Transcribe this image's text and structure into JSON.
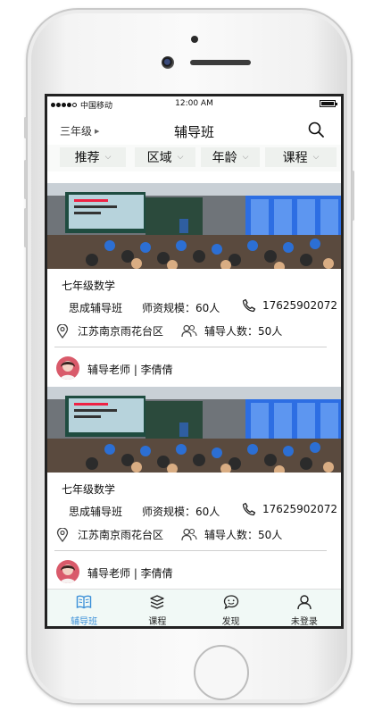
{
  "status_bar": {
    "carrier": "中国移动",
    "time": "12:00 AM"
  },
  "nav": {
    "grade": "三年级",
    "title": "辅导班",
    "search_icon": "search-icon"
  },
  "filters": [
    {
      "label": "推荐"
    },
    {
      "label": "区域"
    },
    {
      "label": "年龄"
    },
    {
      "label": "课程"
    }
  ],
  "listings": [
    {
      "course": "七年级数学",
      "org": "思成辅导班",
      "faculty": "师资规模：60人",
      "phone": "17625902072",
      "address": "江苏南京雨花台区",
      "students": "辅导人数：50人",
      "teacher": "辅导老师 | 李倩倩"
    },
    {
      "course": "七年级数学",
      "org": "思成辅导班",
      "faculty": "师资规模：60人",
      "phone": "17625902072",
      "address": "江苏南京雨花台区",
      "students": "辅导人数：50人",
      "teacher": "辅导老师 | 李倩倩"
    }
  ],
  "tabs": [
    {
      "label": "辅导班",
      "icon": "book-icon",
      "active": true
    },
    {
      "label": "课程",
      "icon": "stack-icon",
      "active": false
    },
    {
      "label": "发现",
      "icon": "chat-smile-icon",
      "active": false
    },
    {
      "label": "未登录",
      "icon": "user-icon",
      "active": false
    }
  ],
  "colors": {
    "accent": "#3a8fd8",
    "tabbar_bg": "#f1f9f6",
    "filter_bg": "#eef1ee"
  }
}
